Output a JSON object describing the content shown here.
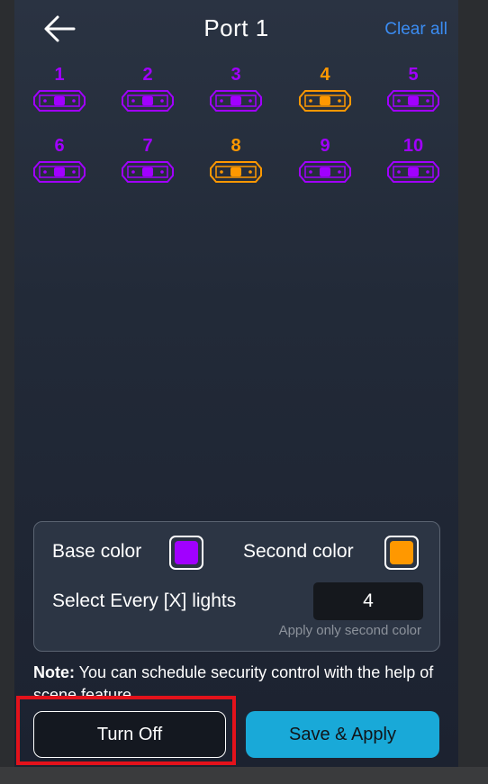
{
  "header": {
    "title": "Port 1",
    "clear_all_label": "Clear all"
  },
  "colors": {
    "base": "#a100ff",
    "second": "#ff9800",
    "accent": "#3b8cf2",
    "apply_button": "#19a9d8"
  },
  "lights": [
    {
      "label": "1",
      "color": "base"
    },
    {
      "label": "2",
      "color": "base"
    },
    {
      "label": "3",
      "color": "base"
    },
    {
      "label": "4",
      "color": "second"
    },
    {
      "label": "5",
      "color": "base"
    },
    {
      "label": "6",
      "color": "base"
    },
    {
      "label": "7",
      "color": "base"
    },
    {
      "label": "8",
      "color": "second"
    },
    {
      "label": "9",
      "color": "base"
    },
    {
      "label": "10",
      "color": "base"
    }
  ],
  "panel": {
    "base_color_label": "Base color",
    "second_color_label": "Second color",
    "select_every_label": "Select Every [X] lights",
    "select_every_value": "4",
    "hint": "Apply only second color"
  },
  "note": {
    "prefix": "Note:",
    "text": " You can schedule security control with the help of scene feature"
  },
  "buttons": {
    "turn_off": "Turn Off",
    "save_apply": "Save & Apply"
  }
}
